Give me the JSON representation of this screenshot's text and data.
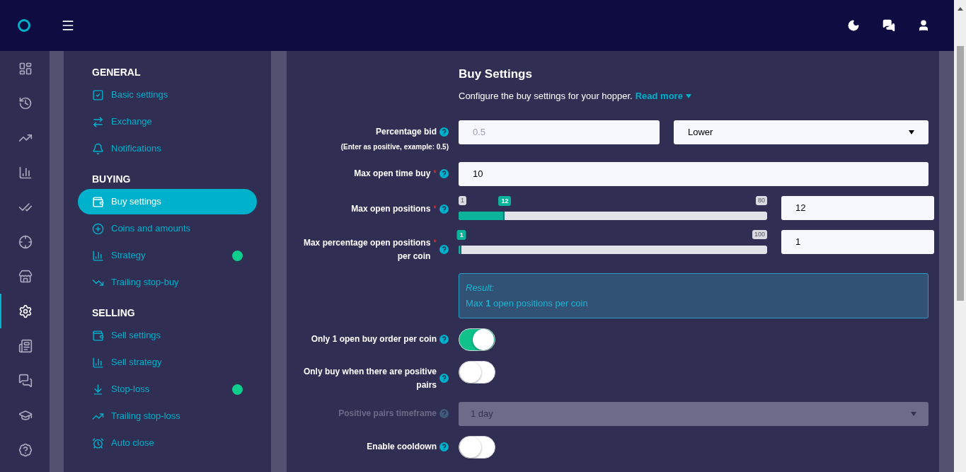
{
  "rail": [
    {
      "selected": false
    },
    {
      "selected": false
    },
    {
      "selected": false
    },
    {
      "selected": false
    },
    {
      "selected": false
    },
    {
      "selected": false
    },
    {
      "selected": false
    },
    {
      "selected": true
    },
    {
      "selected": false
    },
    {
      "selected": false
    },
    {
      "selected": false
    },
    {
      "selected": false
    }
  ],
  "settings_nav": [
    {
      "heading": "GENERAL",
      "items": [
        {
          "kind": "checkbox",
          "label": "Basic settings",
          "selected": false,
          "dot": false
        },
        {
          "kind": "swap",
          "label": "Exchange",
          "selected": false,
          "dot": false
        },
        {
          "kind": "bell",
          "label": "Notifications",
          "selected": false,
          "dot": false
        }
      ]
    },
    {
      "heading": "BUYING",
      "items": [
        {
          "kind": "wallet",
          "label": "Buy settings",
          "selected": true,
          "dot": false
        },
        {
          "kind": "coin",
          "label": "Coins and amounts",
          "selected": false,
          "dot": false
        },
        {
          "kind": "chart",
          "label": "Strategy",
          "selected": false,
          "dot": true
        },
        {
          "kind": "down",
          "label": "Trailing stop-buy",
          "selected": false,
          "dot": false
        }
      ]
    },
    {
      "heading": "SELLING",
      "items": [
        {
          "kind": "wallet",
          "label": "Sell settings",
          "selected": false,
          "dot": false
        },
        {
          "kind": "chart",
          "label": "Sell strategy",
          "selected": false,
          "dot": false
        },
        {
          "kind": "stop",
          "label": "Stop-loss",
          "selected": false,
          "dot": true
        },
        {
          "kind": "up",
          "label": "Trailing stop-loss",
          "selected": false,
          "dot": false
        },
        {
          "kind": "alarm",
          "label": "Auto close",
          "selected": false,
          "dot": false
        }
      ]
    }
  ],
  "main": {
    "title": "Buy Settings",
    "intro": "Configure the buy settings for your hopper.",
    "read_more": "Read more",
    "rows": [
      {
        "kind": "input_select",
        "label": "Percentage bid",
        "note": "(Enter as positive, example: 0.5)",
        "placeholder": "0.5",
        "select_value": "Lower"
      },
      {
        "kind": "input",
        "label": "Max open time buy",
        "required_mark": "*",
        "value": "10"
      },
      {
        "kind": "slider",
        "label": "Max open positions",
        "required_mark": "*",
        "min": "1",
        "max": "80",
        "thumb": "12",
        "level": 0.15,
        "value": "12"
      },
      {
        "kind": "slider",
        "label": "Max percentage open positions per coin",
        "required_mark": "*",
        "max": "100",
        "thumb": "1",
        "level": 0.01,
        "value": "1"
      },
      {
        "kind": "result",
        "title": "Result:",
        "text": "Max **1** open positions per coin"
      },
      {
        "kind": "toggle",
        "label": "Only 1 open buy order per coin",
        "on": true
      },
      {
        "kind": "toggle",
        "label": "Only buy when there are positive pairs",
        "on": false
      },
      {
        "kind": "select",
        "label": "Positive pairs timeframe",
        "value": "1 day",
        "disabled": true
      },
      {
        "kind": "toggle",
        "label": "Enable cooldown",
        "on": false
      }
    ]
  }
}
